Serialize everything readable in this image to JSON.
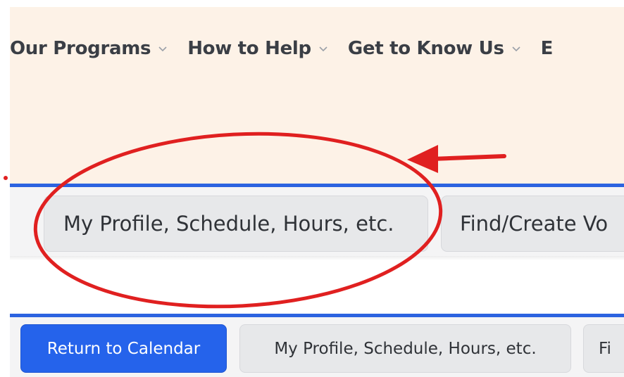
{
  "nav": {
    "items": [
      {
        "label": "Our Programs",
        "icon": "chevron-down-icon"
      },
      {
        "label": "How to Help",
        "icon": "chevron-down-icon"
      },
      {
        "label": "Get to Know Us",
        "icon": "chevron-down-icon"
      },
      {
        "label": "E",
        "icon": ""
      }
    ]
  },
  "zoomed_bar": {
    "buttons": [
      {
        "label": "My Profile, Schedule, Hours, etc."
      },
      {
        "label": "Find/Create Vo"
      }
    ]
  },
  "bottom_bar": {
    "buttons": [
      {
        "label": "Return to Calendar"
      },
      {
        "label": "My Profile, Schedule, Hours, etc."
      },
      {
        "label": "Fi"
      }
    ]
  },
  "annotation": {
    "shape": "circle-and-arrow",
    "color": "#e02020"
  },
  "colors": {
    "nav_background": "#fdf2e7",
    "accent_blue": "#2c63e0",
    "primary_button": "#2563eb",
    "secondary_button": "#e7e8ea",
    "text": "#3a3e45"
  }
}
